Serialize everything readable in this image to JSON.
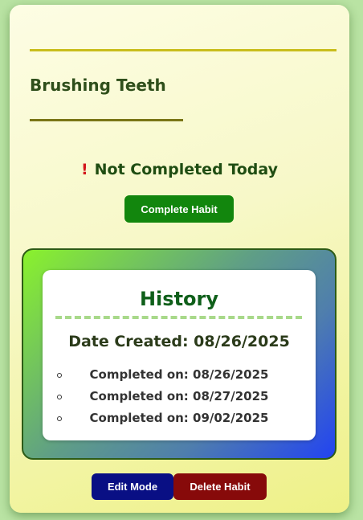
{
  "habit": {
    "title": "Brushing Teeth",
    "status_icon": "!",
    "status_icon_name": "exclamation-icon",
    "status_text": "Not Completed Today",
    "complete_label": "Complete Habit"
  },
  "history": {
    "title": "History",
    "date_created": "Date Created: 08/26/2025",
    "completions": [
      "Completed on: 08/26/2025",
      "Completed on: 08/27/2025",
      "Completed on: 09/02/2025"
    ]
  },
  "actions": {
    "edit_label": "Edit Mode",
    "delete_label": "Delete Habit"
  },
  "colors": {
    "complete": "#12860d",
    "edit": "#090f84",
    "delete": "#870a0a",
    "warning": "#d3161b"
  }
}
